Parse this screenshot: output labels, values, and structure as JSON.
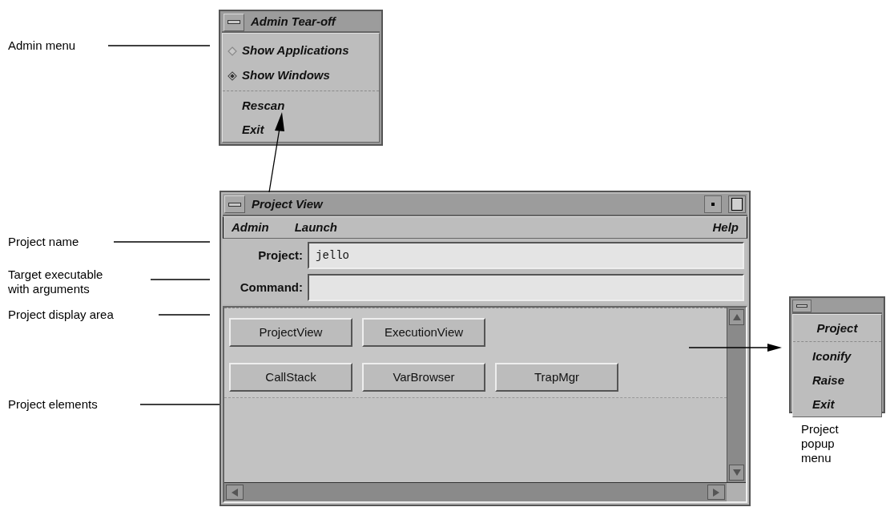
{
  "callouts": [
    "Admin menu",
    "Project name",
    "Target executable with arguments",
    "Project display area",
    "Project elements"
  ],
  "admin_menu": {
    "title": "Admin Tear-off",
    "items": [
      {
        "kind": "radio",
        "label": "Show Applications",
        "selected": false
      },
      {
        "kind": "radio",
        "label": "Show Windows",
        "selected": true
      },
      {
        "kind": "separator"
      },
      {
        "kind": "command",
        "label": "Rescan"
      },
      {
        "kind": "command",
        "label": "Exit"
      }
    ]
  },
  "project_window": {
    "title": "Project View",
    "menus_left": [
      "Admin",
      "Launch"
    ],
    "menus_right": [
      "Help"
    ],
    "fields": [
      {
        "label": "Project:",
        "value": "jello"
      },
      {
        "label": "Command:"
      }
    ],
    "element_rows": [
      [
        "ProjectView",
        "ExecutionView"
      ],
      [
        "CallStack",
        "VarBrowser",
        "TrapMgr"
      ]
    ]
  },
  "popup_menu": {
    "items": [
      {
        "kind": "title",
        "label": "Project"
      },
      {
        "kind": "separator"
      },
      {
        "kind": "command",
        "label": "Iconify"
      },
      {
        "kind": "command",
        "label": "Raise"
      },
      {
        "kind": "command",
        "label": "Exit"
      }
    ],
    "caption": "Project popup menu"
  }
}
